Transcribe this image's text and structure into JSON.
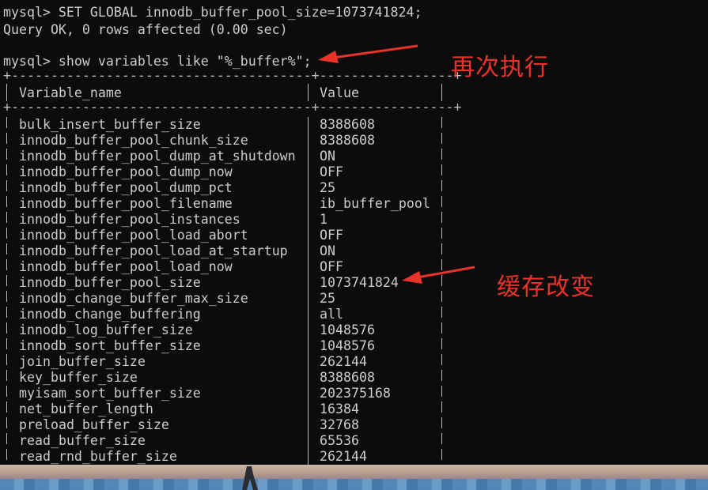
{
  "terminal": {
    "prompt_line_1": "mysql> SET GLOBAL innodb_buffer_pool_size=1073741824;",
    "result_line": "Query OK, 0 rows affected (0.00 sec)",
    "prompt_line_2": "mysql> show variables like \"%_buffer%\";",
    "border_top": "+--------------------------------------+-----------------+",
    "header_name": "Variable_name",
    "header_value": "Value",
    "border_mid": "+--------------------------------------+-----------------+"
  },
  "rows": [
    {
      "name": "bulk_insert_buffer_size",
      "value": "8388608"
    },
    {
      "name": "innodb_buffer_pool_chunk_size",
      "value": "8388608"
    },
    {
      "name": "innodb_buffer_pool_dump_at_shutdown",
      "value": "ON"
    },
    {
      "name": "innodb_buffer_pool_dump_now",
      "value": "OFF"
    },
    {
      "name": "innodb_buffer_pool_dump_pct",
      "value": "25"
    },
    {
      "name": "innodb_buffer_pool_filename",
      "value": "ib_buffer_pool"
    },
    {
      "name": "innodb_buffer_pool_instances",
      "value": "1"
    },
    {
      "name": "innodb_buffer_pool_load_abort",
      "value": "OFF"
    },
    {
      "name": "innodb_buffer_pool_load_at_startup",
      "value": "ON"
    },
    {
      "name": "innodb_buffer_pool_load_now",
      "value": "OFF"
    },
    {
      "name": "innodb_buffer_pool_size",
      "value": "1073741824"
    },
    {
      "name": "innodb_change_buffer_max_size",
      "value": "25"
    },
    {
      "name": "innodb_change_buffering",
      "value": "all"
    },
    {
      "name": "innodb_log_buffer_size",
      "value": "1048576"
    },
    {
      "name": "innodb_sort_buffer_size",
      "value": "1048576"
    },
    {
      "name": "join_buffer_size",
      "value": "262144"
    },
    {
      "name": "key_buffer_size",
      "value": "8388608"
    },
    {
      "name": "myisam_sort_buffer_size",
      "value": "202375168"
    },
    {
      "name": "net_buffer_length",
      "value": "16384"
    },
    {
      "name": "preload_buffer_size",
      "value": "32768"
    },
    {
      "name": "read_buffer_size",
      "value": "65536"
    },
    {
      "name": "read_rnd_buffer_size",
      "value": "262144"
    }
  ],
  "annotations": {
    "rerun_label": "再次执行",
    "cache_changed_label": "缓存改变",
    "color": "#e8322a"
  },
  "colors": {
    "terminal_bg": "#0c0c0c",
    "terminal_text": "#cccccc"
  }
}
